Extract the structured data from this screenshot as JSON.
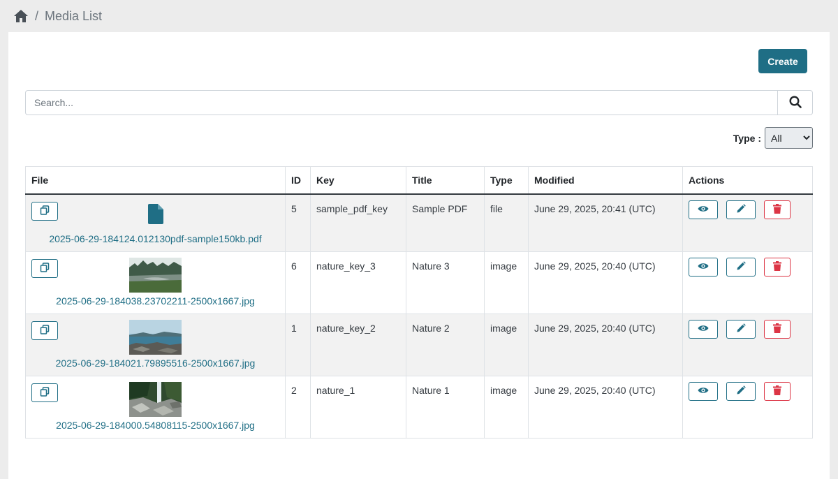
{
  "breadcrumb": {
    "home_icon": "home-icon",
    "separator": "/",
    "current": "Media List"
  },
  "toolbar": {
    "create_label": "Create"
  },
  "search": {
    "placeholder": "Search...",
    "value": "",
    "icon": "search-icon"
  },
  "filter": {
    "type_label": "Type :",
    "type_selected": "All"
  },
  "table": {
    "headers": [
      "File",
      "ID",
      "Key",
      "Title",
      "Type",
      "Modified",
      "Actions"
    ],
    "rows": [
      {
        "file_kind": "file",
        "file_icon": "file-icon",
        "filename": "2025-06-29-184124.012130pdf-sample150kb.pdf",
        "id": "5",
        "key": "sample_pdf_key",
        "title": "Sample PDF",
        "type": "file",
        "modified": "June 29, 2025, 20:41 (UTC)"
      },
      {
        "file_kind": "image",
        "thumb": "misty-lake-forest",
        "filename": "2025-06-29-184038.23702211-2500x1667.jpg",
        "id": "6",
        "key": "nature_key_3",
        "title": "Nature 3",
        "type": "image",
        "modified": "June 29, 2025, 20:40 (UTC)"
      },
      {
        "file_kind": "image",
        "thumb": "sea-shore-rocks",
        "filename": "2025-06-29-184021.79895516-2500x1667.jpg",
        "id": "1",
        "key": "nature_key_2",
        "title": "Nature 2",
        "type": "image",
        "modified": "June 29, 2025, 20:40 (UTC)"
      },
      {
        "file_kind": "image",
        "thumb": "waterfall-rocks",
        "filename": "2025-06-29-184000.54808115-2500x1667.jpg",
        "id": "2",
        "key": "nature_1",
        "title": "Nature 1",
        "type": "image",
        "modified": "June 29, 2025, 20:40 (UTC)"
      }
    ]
  },
  "colors": {
    "primary": "#1f6e85",
    "danger": "#dc3545",
    "stripe": "#f2f2f2",
    "page_bg": "#ececec"
  }
}
